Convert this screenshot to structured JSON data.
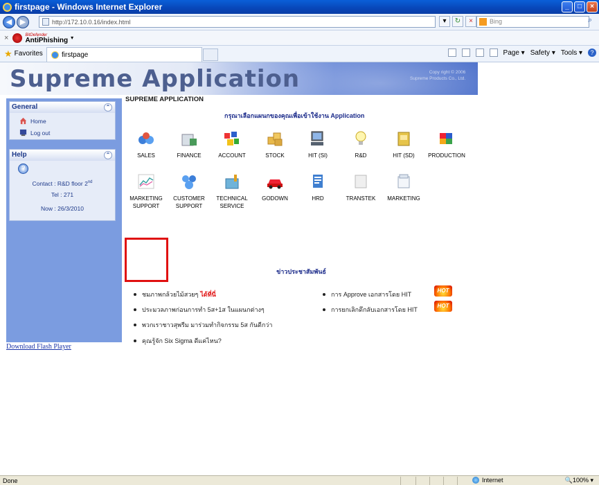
{
  "window": {
    "title": "firstpage - Windows Internet Explorer",
    "minimize": "_",
    "maximize": "□",
    "close": "×"
  },
  "nav": {
    "back": "◀",
    "forward": "▶",
    "address": "http://172.10.0.16/index.html",
    "search_placeholder": "Bing",
    "search_icon": "magnifier-icon"
  },
  "toolbar": {
    "close_x": "×",
    "antiphishing_label": "AntiPhishing",
    "bitdefender": "BitDefender"
  },
  "favbar": {
    "favorites_label": "Favorites",
    "tab_label": "firstpage",
    "page_menu": "Page ▾",
    "safety_menu": "Safety ▾",
    "tools_menu": "Tools ▾"
  },
  "banner": {
    "title": "Supreme Application",
    "copyright_line1": "Copy right © 2006",
    "copyright_line2": "Supreme Products Co., Ltd."
  },
  "sidebar": {
    "general": {
      "heading": "General",
      "items": [
        "Home",
        "Log out"
      ]
    },
    "help": {
      "heading": "Help",
      "contact": "Contact : R&D floor 2",
      "contact_sup": "nd",
      "tel": "Tel : 271",
      "now": "Now : 26/3/2010"
    }
  },
  "main": {
    "section_title": "SUPREME APPLICATION",
    "subtitle": "กรุณาเลือกแผนกของคุณเพื่อเข้าใช้งาน Application",
    "row1": [
      "SALES",
      "FINANCE",
      "ACCOUNT",
      "STOCK",
      "HIT (SI)",
      "R&D",
      "HIT (SD)",
      "PRODUCTION"
    ],
    "row2": [
      {
        "l1": "MARKETING",
        "l2": "SUPPORT"
      },
      {
        "l1": "CUSTOMER",
        "l2": "SUPPORT"
      },
      {
        "l1": "TECHNICAL",
        "l2": "SERVICE"
      },
      {
        "l1": "GODOWN",
        "l2": ""
      },
      {
        "l1": "HRD",
        "l2": ""
      },
      {
        "l1": "TRANSTEK",
        "l2": ""
      },
      {
        "l1": "MARKETING",
        "l2": ""
      }
    ],
    "selected_module": "MARKETING SUPPORT"
  },
  "news": {
    "heading": "ข่าวประชาสัมพันธ์",
    "left": [
      {
        "text": "ชมภาพกล้วยไม้สวยๆ",
        "link": "ได้ที่นี่"
      },
      {
        "text": "ประมวลภาพก่อนการทำ 5ส+1ส ในแผนกต่างๆ",
        "link": ""
      },
      {
        "text": "พวกเราชาวสุพรีม มาร่วมทำกิจกรรม 5ส กันดีกว่า",
        "link": ""
      },
      {
        "text": "คุณรู้จัก Six Sigma ดีแค่ไหน?",
        "link": ""
      }
    ],
    "right": [
      "การ Approve เอกสารโดย HIT",
      "การยกเลิกดึกลับเอกสารโดย HIT"
    ],
    "hot_label": "HOT"
  },
  "download_flash": "Download Flash Player",
  "status": {
    "left": "Done",
    "zone": "Internet",
    "zoom": "100%"
  },
  "colors": {
    "banner_title": "#4d5f8f",
    "sidebar_bg": "#7b9ce0",
    "selection": "#e01010"
  }
}
